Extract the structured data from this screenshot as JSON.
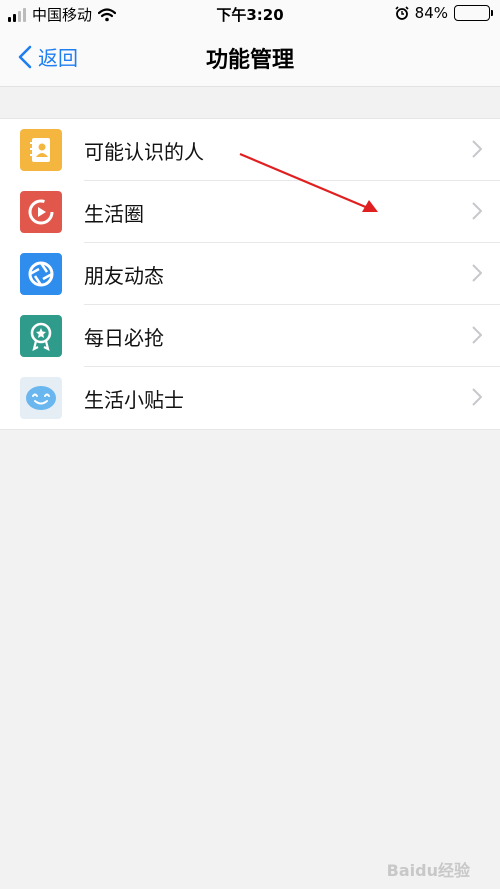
{
  "status_bar": {
    "carrier": "中国移动",
    "time": "下午3:20",
    "battery_text": "84%",
    "battery_level": 0.84
  },
  "nav": {
    "back_label": "返回",
    "title": "功能管理"
  },
  "items": [
    {
      "label": "可能认识的人",
      "icon": "contacts-book-icon",
      "color": "#f4b63e"
    },
    {
      "label": "生活圈",
      "icon": "life-circle-play-icon",
      "color": "#e2574c"
    },
    {
      "label": "朋友动态",
      "icon": "friend-feed-aperture-icon",
      "color": "#2f8ded"
    },
    {
      "label": "每日必抢",
      "icon": "daily-deal-badge-icon",
      "color": "#2f9b8b"
    },
    {
      "label": "生活小贴士",
      "icon": "life-tips-smiley-icon",
      "color": "#6ab6ee"
    }
  ],
  "watermark": "Baidu经验",
  "colors": {
    "accent": "#1f7ef0",
    "annotation_arrow": "#e02020"
  }
}
